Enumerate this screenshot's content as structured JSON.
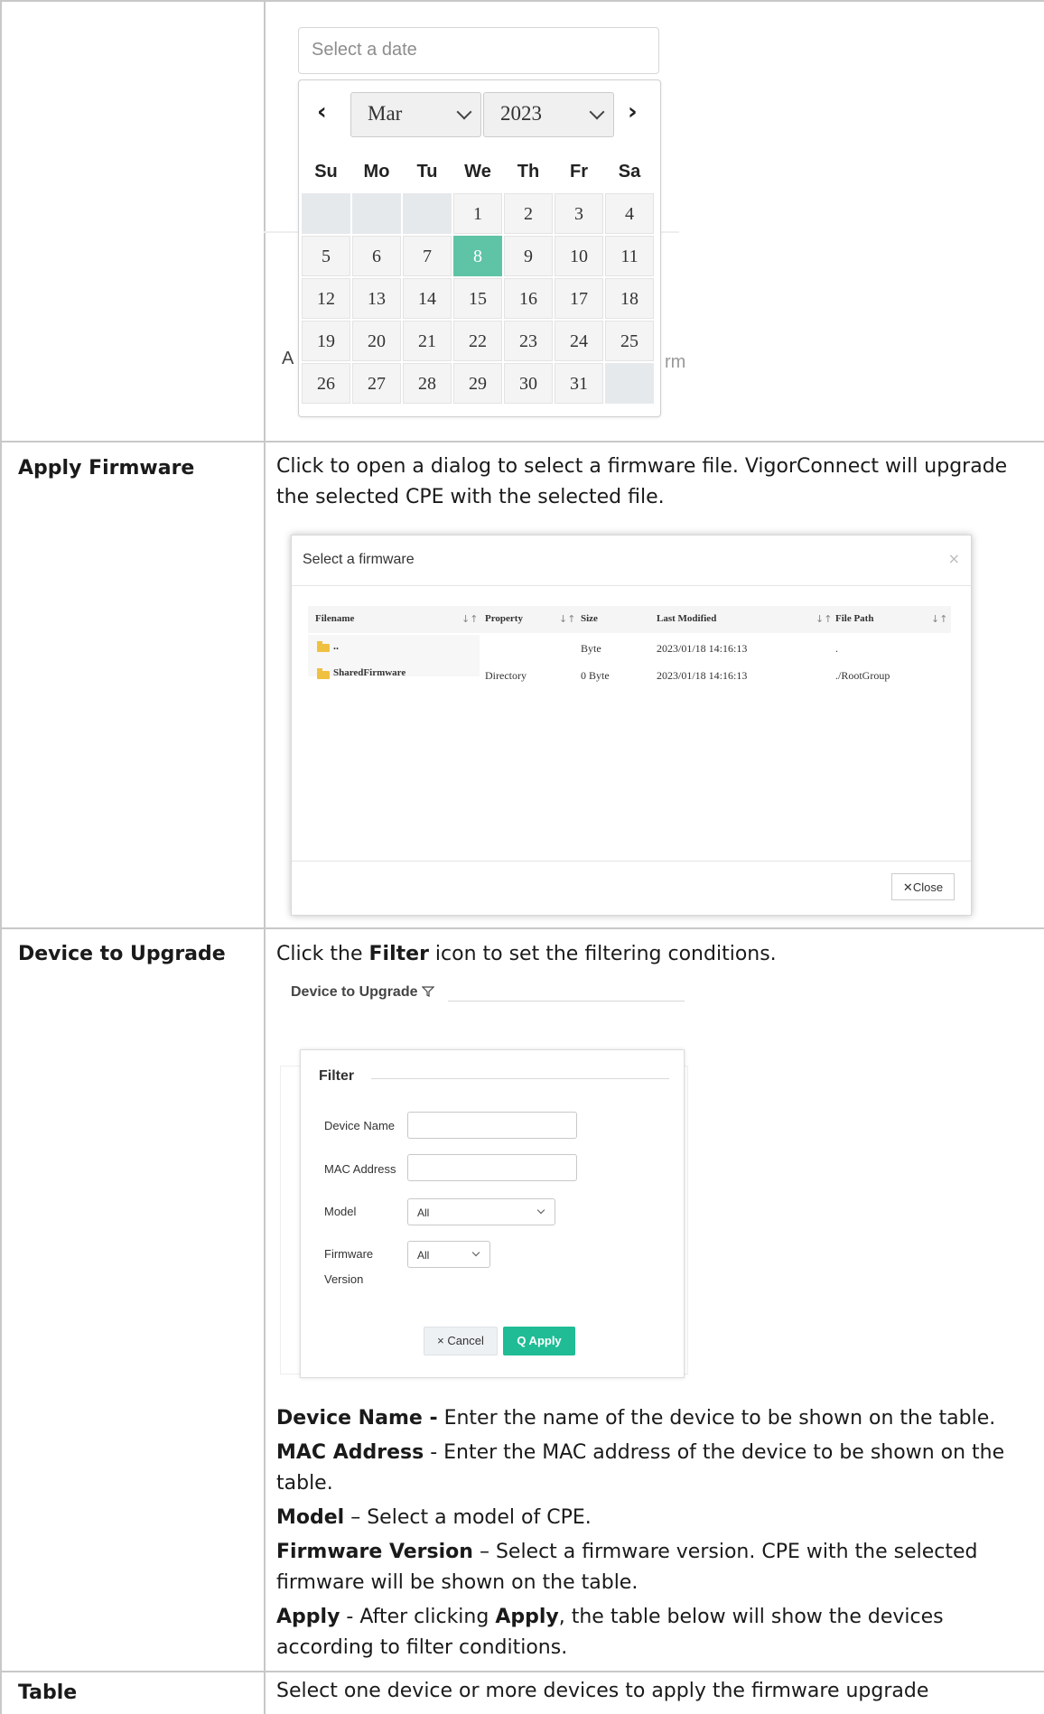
{
  "date_picker": {
    "placeholder": "Select a date",
    "prev_icon": "chevron-left-icon",
    "next_icon": "chevron-right-icon",
    "month": "Mar",
    "year": "2023",
    "weekdays": [
      "Su",
      "Mo",
      "Tu",
      "We",
      "Th",
      "Fr",
      "Sa"
    ],
    "weeks": [
      [
        "",
        "",
        "",
        "1",
        "2",
        "3",
        "4"
      ],
      [
        "5",
        "6",
        "7",
        "8",
        "9",
        "10",
        "11"
      ],
      [
        "12",
        "13",
        "14",
        "15",
        "16",
        "17",
        "18"
      ],
      [
        "19",
        "20",
        "21",
        "22",
        "23",
        "24",
        "25"
      ],
      [
        "26",
        "27",
        "28",
        "29",
        "30",
        "31",
        ""
      ]
    ],
    "selected_day": "8",
    "selected_color": "#5fc4a6",
    "background_fragments": [
      "A",
      "rm"
    ]
  },
  "rows": {
    "apply_firmware": {
      "label": "Apply Firmware",
      "description": "Click to open a dialog to select a firmware file. VigorConnect will upgrade the selected CPE with the selected file."
    },
    "device_to_upgrade": {
      "label": "Device to Upgrade",
      "intro_pre": "Click the ",
      "intro_bold": "Filter",
      "intro_post": " icon to set the filtering conditions.",
      "notes": [
        {
          "term": "Device Name -",
          "text": " Enter the name of the device to be shown on the table."
        },
        {
          "term": "MAC Address",
          "text": " - Enter the MAC address of the device to be shown on the table."
        },
        {
          "term": "Model",
          "text": " – Select a model of CPE."
        },
        {
          "term": "Firmware Version",
          "text": " – Select a firmware version. CPE with the selected firmware will be shown on the table."
        }
      ],
      "apply_note": {
        "term": "Apply",
        "pre": " - After clicking ",
        "bold": "Apply",
        "post": ", the table below will show the devices according to filter conditions."
      }
    },
    "table": {
      "label": "Table",
      "description": "Select one device or more devices to apply the firmware upgrade"
    }
  },
  "firmware_dialog": {
    "title": "Select a firmware",
    "close_icon": "x-icon",
    "columns": [
      "Filename",
      "Property",
      "Size",
      "Last Modified",
      "File Path"
    ],
    "files": [
      {
        "name": "..",
        "property": "",
        "size": "Byte",
        "modified": "2023/01/18 14:16:13",
        "path": "."
      },
      {
        "name": "SharedFirmware",
        "property": "Directory",
        "size": "0 Byte",
        "modified": "2023/01/18 14:16:13",
        "path": "./RootGroup"
      }
    ],
    "close_label": "✕Close"
  },
  "filter_panel": {
    "heading": "Device to Upgrade",
    "filter_icon": "filter-icon",
    "title": "Filter",
    "device_name_label": "Device Name",
    "mac_label": "MAC Address",
    "model_label": "Model",
    "model_value": "All",
    "firmware_label_1": "Firmware",
    "firmware_label_2": "Version",
    "firmware_value": "All",
    "cancel_label": "× Cancel",
    "apply_label": "Q Apply",
    "apply_color": "#1fbc95"
  }
}
